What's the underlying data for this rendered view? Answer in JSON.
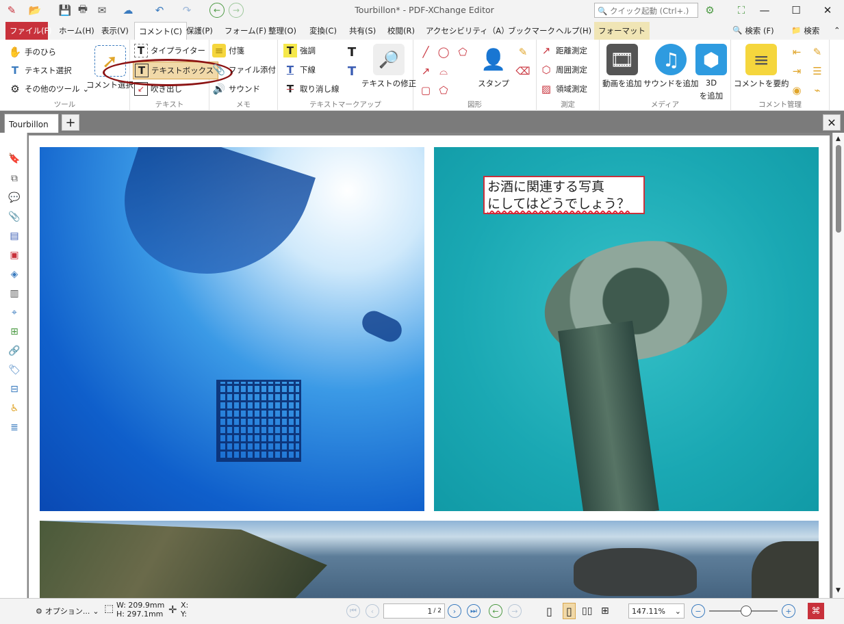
{
  "window": {
    "title": "Tourbillon* - PDF-XChange Editor",
    "search_placeholder": "クイック起動 (Ctrl+.)"
  },
  "menu": {
    "tabs": [
      "ファイル(F)",
      "ホーム(H)",
      "表示(V)",
      "コメント(C)",
      "保護(P)",
      "フォーム(F)",
      "整理(O)",
      "変換(C)",
      "共有(S)",
      "校閲(R)",
      "アクセシビリティ（A）",
      "ブックマーク",
      "ヘルプ(H)",
      "フォーマット"
    ],
    "right_search1": "検索 (F)",
    "right_search2": "検索"
  },
  "ribbon": {
    "tools": {
      "hand": "手のひら",
      "select_text": "テキスト選択",
      "other_tools": "その他のツール",
      "select_comments": "コメント選択",
      "label": "ツール"
    },
    "text": {
      "typewriter": "タイプライター",
      "textbox": "テキストボックス",
      "callout": "吹き出し",
      "label": "テキスト"
    },
    "notes": {
      "sticky": "付箋",
      "attach": "ファイル添付",
      "sound": "サウンド",
      "label": "メモ"
    },
    "markup": {
      "highlight": "強調",
      "underline": "下線",
      "strike": "取り消し線",
      "text_fix": "テキストの修正",
      "label": "テキストマークアップ"
    },
    "shapes": {
      "stamp": "スタンプ",
      "label": "図形"
    },
    "measure": {
      "distance": "距離測定",
      "perimeter": "周囲測定",
      "area": "領域測定",
      "label": "測定"
    },
    "media": {
      "add_video": "動画を追加",
      "add_sound": "サウンドを追加",
      "add_3d_line1": "3D",
      "add_3d_line2": "を追加",
      "label": "メディア"
    },
    "manage": {
      "summarize": "コメントを要約",
      "label": "コメント管理"
    }
  },
  "doc": {
    "tab": "Tourbillon",
    "annotation_line1": "お酒に関連する写真",
    "annotation_line2": "にしてはどうでしょう？"
  },
  "status": {
    "options": "オプション...",
    "width": "W: 209.9mm",
    "height": "H: 297.1mm",
    "x": "X:",
    "y": "Y:",
    "page": "1",
    "page_total": "/ 2",
    "zoom": "147.11%"
  }
}
